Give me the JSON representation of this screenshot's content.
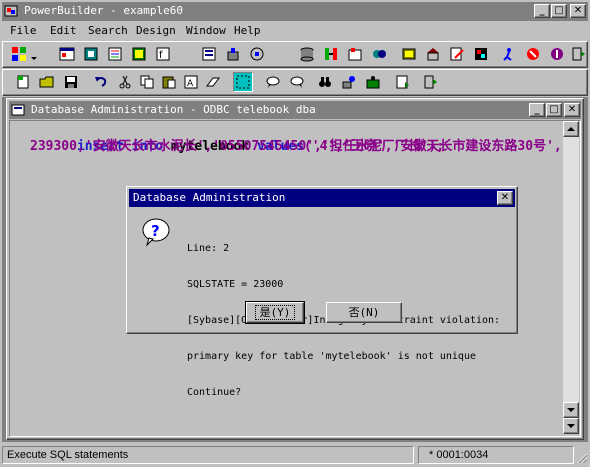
{
  "app": {
    "title": "PowerBuilder - example60"
  },
  "menu": {
    "file": "File",
    "edit": "Edit",
    "search": "Search",
    "design": "Design",
    "window": "Window",
    "help": "Help"
  },
  "child_window": {
    "title": "Database Administration - ODBC telebook dba",
    "code": {
      "line1_insert": "insert",
      "line1_into": "into",
      "line1_table": "mytelebook",
      "line1_values": "values",
      "line1_args": "('4','王晓','安徽天长市建设东路30号',",
      "line2": "239300,'安徽天长市水泥长','05507545450','担任水泥厂厂长');"
    }
  },
  "dialog": {
    "title": "Database Administration",
    "line_label": "Line: 2",
    "sqlstate": "SQLSTATE = 23000",
    "message1": "[Sybase][ODBC Driver]Integrity constraint violation:",
    "message2": "primary key for table 'mytelebook' is not unique",
    "message3": "Continue?",
    "yes_label": "是(Y)",
    "no_label": "否(N)"
  },
  "status": {
    "message": "Execute SQL statements",
    "position": "* 0001:0034"
  },
  "colors": {
    "active_title": "#000080",
    "inactive_title": "#808080",
    "keyword": "#1a1acd",
    "string": "#8b008b"
  }
}
